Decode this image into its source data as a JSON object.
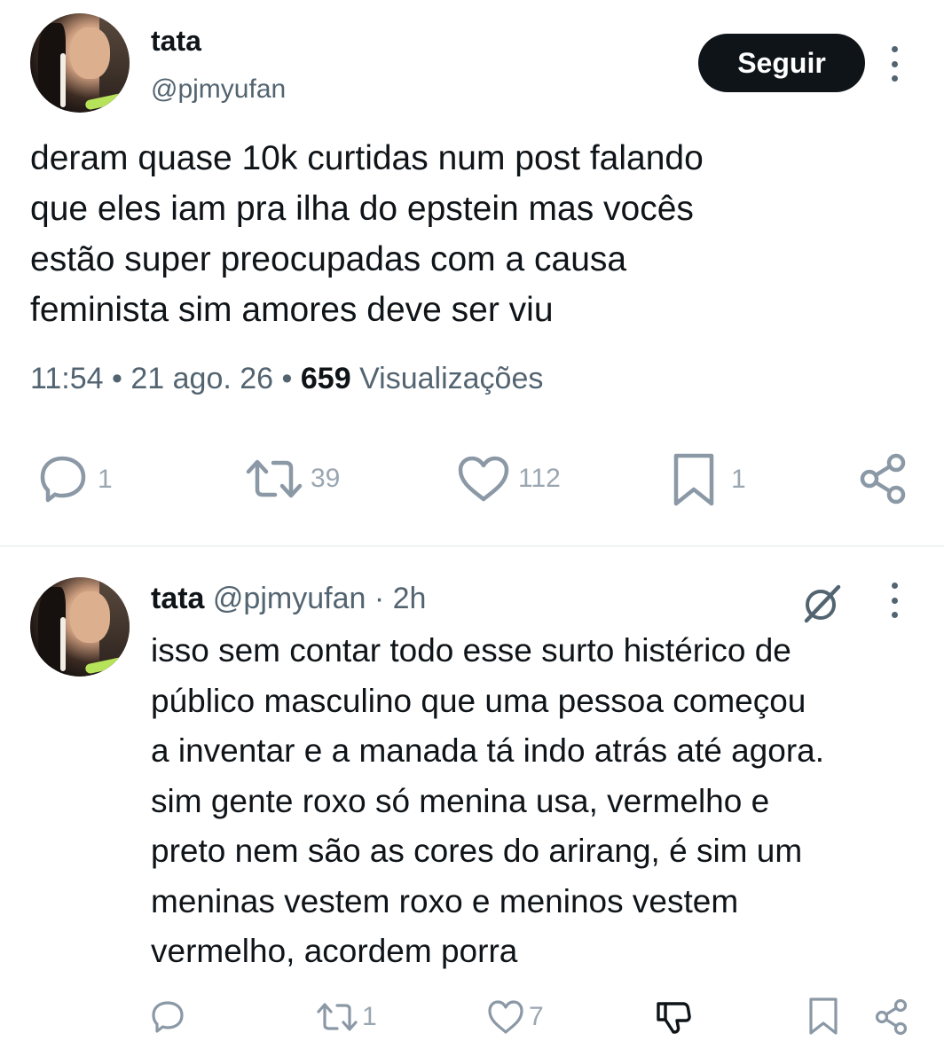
{
  "main_post": {
    "author_name": "tata",
    "author_handle": "@pjmyufan",
    "follow_label": "Seguir",
    "text": "deram quase 10k curtidas num post falando\nque eles iam pra ilha do epstein mas vocês\nestão super preocupadas com a causa\nfeminista sim amores deve ser viu",
    "time": "11:54",
    "date": "21 ago. 26",
    "views_count": "659",
    "views_label": "Visualizações",
    "separator": "•",
    "stats": {
      "replies": "1",
      "reposts": "39",
      "likes": "112",
      "bookmarks": "1"
    }
  },
  "reply_post": {
    "author_name": "tata",
    "author_handle": "@pjmyufan",
    "time_ago": "· 2h",
    "text": "isso sem contar todo esse surto histérico de\npúblico masculino que uma pessoa começou\na inventar e a manada tá indo atrás até agora.\nsim gente roxo só menina usa, vermelho e\npreto nem são as cores do arirang, é sim um\nmeninas vestem roxo e meninos vestem\nvermelho, acordem porra",
    "stats": {
      "reposts": "1",
      "likes": "7"
    }
  },
  "icons": {
    "reply": "reply-icon",
    "repost": "repost-icon",
    "like": "heart-icon",
    "bookmark": "bookmark-icon",
    "share": "share-icon",
    "more": "more-icon",
    "grok": "grok-icon",
    "downvote": "thumbs-down-icon"
  },
  "colors": {
    "text_primary": "#0f1419",
    "text_secondary": "#536471",
    "icon_muted": "#8b98a5",
    "follow_button_bg": "#0f1419"
  }
}
